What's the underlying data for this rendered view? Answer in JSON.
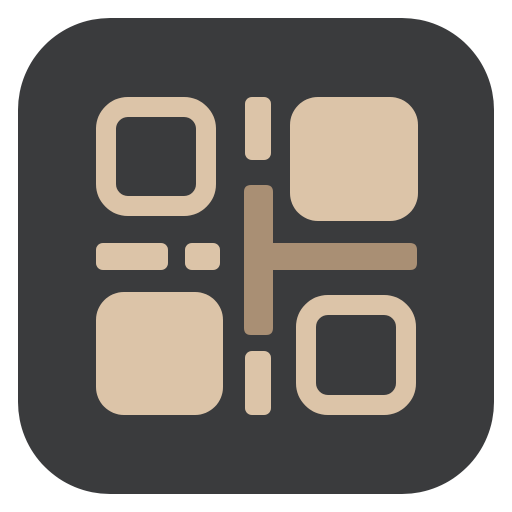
{
  "app_icon": {
    "icon_name": "qr-code-icon",
    "colors": {
      "background": "#3a3b3d",
      "module": "#dcc4a8",
      "accent": "#a98f74",
      "page": "#ffffff"
    }
  }
}
